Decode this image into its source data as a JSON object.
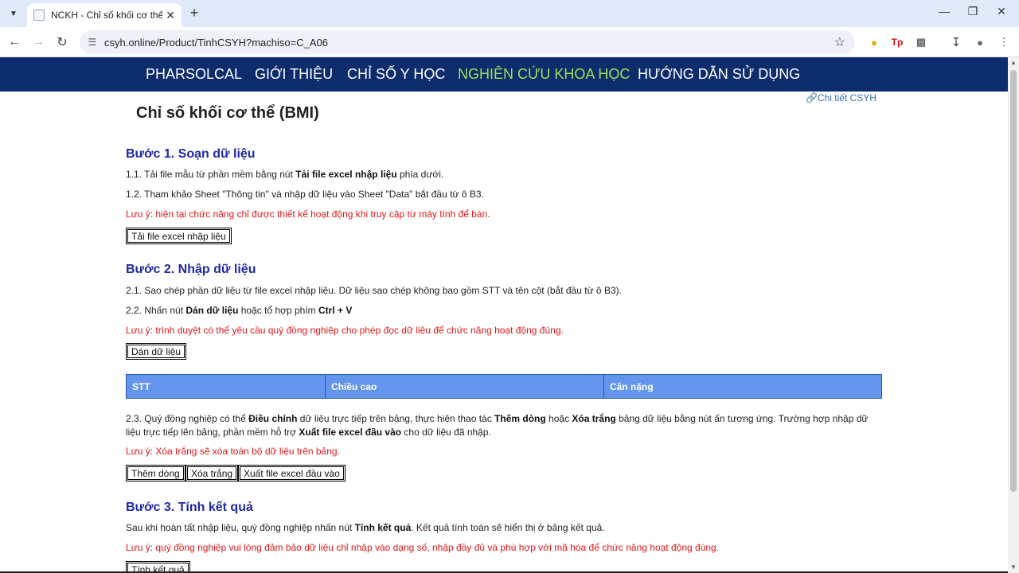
{
  "browser": {
    "tab_title": "NCKH - Chỉ số khối cơ thể (BMI)",
    "url": "csyh.online/Product/TinhCSYH?machiso=C_A06"
  },
  "nav": {
    "items": [
      "PHARSOLCAL",
      "GIỚI THIỆU",
      "CHỈ SỐ Y HỌC",
      "NGHIÊN CỨU KHOA HỌC",
      "HƯỚNG DẪN SỬ DỤNG"
    ],
    "active_color": "#9ee25a",
    "background": "#0d2c6c"
  },
  "page": {
    "csyh_link": "Chi tiết CSYH",
    "title": "Chỉ số khối cơ thể (BMI)"
  },
  "step1": {
    "heading": "Bước 1. Soạn dữ liệu",
    "p1_pre": "1.1. Tải file mẫu từ phần mềm bằng nút ",
    "p1_bold": "Tải file excel nhập liệu",
    "p1_post": " phía dưới.",
    "p2": "1.2. Tham khảo Sheet \"Thông tin\" và nhập dữ liệu vào Sheet \"Data\" bắt đầu từ ô B3.",
    "note": "Lưu ý: hiện tại chức năng chỉ được thiết kế hoạt động khi truy cập từ máy tính để bàn.",
    "button": "Tải file excel nhập liệu"
  },
  "step2": {
    "heading": "Bước 2. Nhập dữ liệu",
    "p1": "2.1. Sao chép phần dữ liệu từ file excel nhập liệu. Dữ liệu sao chép không bao gồm STT và tên cột (bắt đầu từ ô B3).",
    "p2_pre": "2.2. Nhấn nút ",
    "p2_bold1": "Dán dữ liệu",
    "p2_mid": " hoặc tổ hợp phím ",
    "p2_bold2": "Ctrl + V",
    "note": "Lưu ý: trình duyệt có thể yêu cầu quý đồng nghiệp cho phép đọc dữ liệu để chức năng hoạt động đúng.",
    "button": "Dán dữ liệu",
    "table_headers": [
      "STT",
      "Chiều cao",
      "Cân nặng"
    ],
    "p3_a": "2.3. Quý đồng nghiệp có thể ",
    "p3_b1": "Điều chỉnh",
    "p3_c": " dữ liệu trực tiếp trên bảng, thực hiện thao tác ",
    "p3_b2": "Thêm dòng",
    "p3_d": " hoặc ",
    "p3_b3": "Xóa trắng",
    "p3_e": " bảng dữ liệu bằng nút ấn tương ứng. Trường hợp nhập dữ liệu trực tiếp lên bảng, phần mềm hỗ trợ ",
    "p3_b4": "Xuất file excel đầu vào",
    "p3_f": " cho dữ liệu đã nhập.",
    "note2": "Lưu ý: Xóa trắng sẽ xóa toàn bộ dữ liệu trên bảng.",
    "buttons": [
      "Thêm dòng",
      "Xóa trắng",
      "Xuất file excel đầu vào"
    ]
  },
  "step3": {
    "heading": "Bước 3. Tính kết quả",
    "p1_pre": "Sau khi hoàn tất nhập liệu, quý đồng nghiệp nhấn nút ",
    "p1_bold": "Tính kết quả",
    "p1_post": ". Kết quả tính toán sẽ hiển thị ở bảng kết quả.",
    "note": "Lưu ý: quý đồng nghiệp vui lòng đảm bảo dữ liệu chỉ nhập vào dạng số, nhập đầy đủ và phù hợp với mã hóa để chức năng hoạt động đúng.",
    "button": "Tính kết quả"
  }
}
